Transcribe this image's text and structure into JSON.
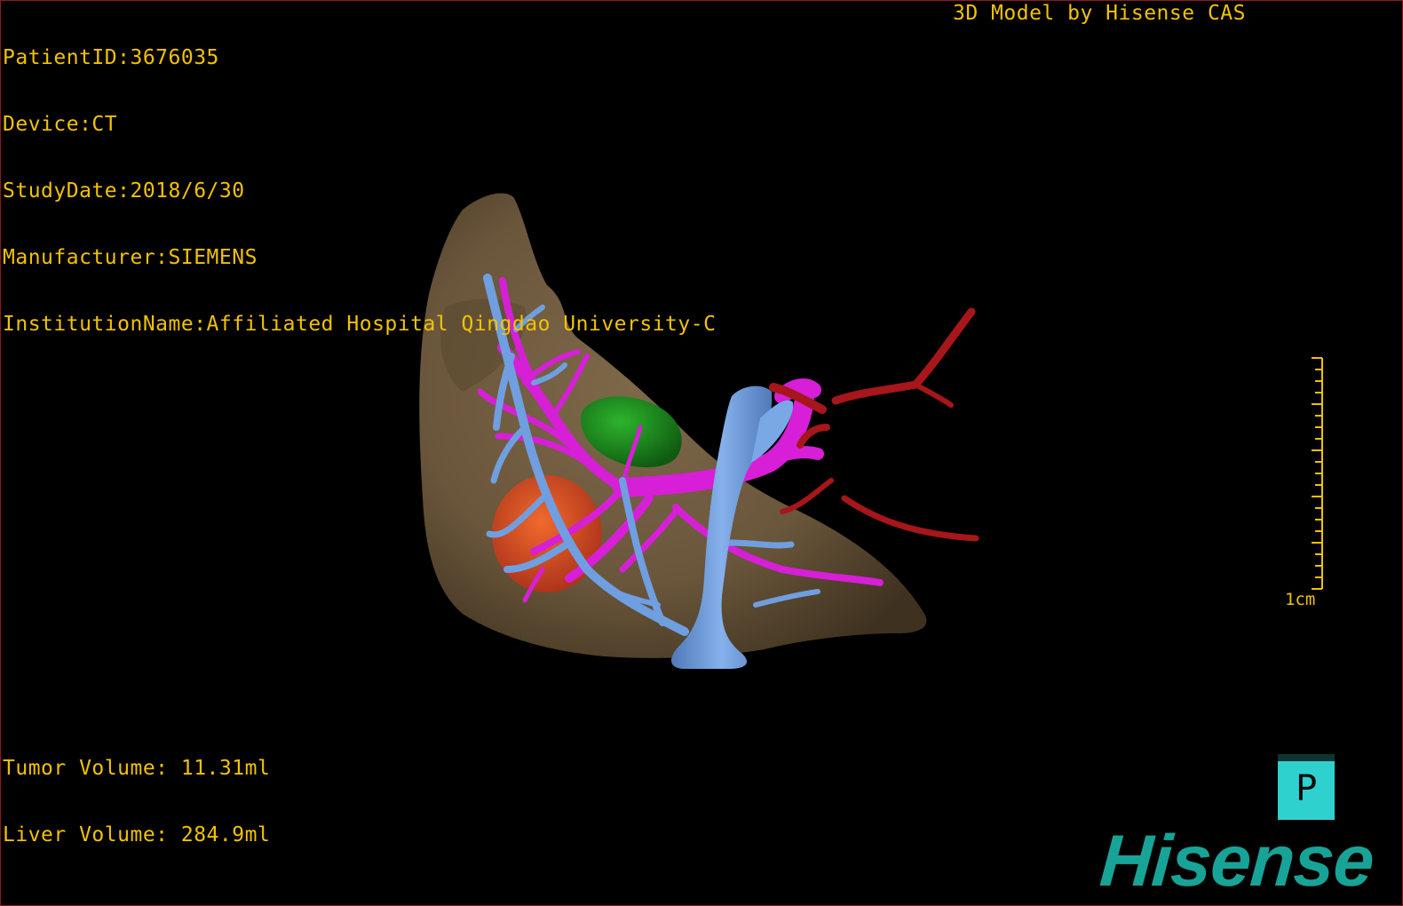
{
  "patient_info": {
    "patient_id": "PatientID:3676035",
    "device": "Device:CT",
    "study_date": "StudyDate:2018/6/30",
    "manufacturer": "Manufacturer:SIEMENS",
    "institution": "InstitutionName:Affiliated Hospital Qingdao University-C"
  },
  "credit": "3D Model by Hisense CAS",
  "volumes": {
    "tumor": "Tumor Volume: 11.31ml",
    "liver": "Liver Volume: 284.9ml"
  },
  "scale_bar": {
    "label": "1cm"
  },
  "orientation_cube": {
    "label": "P"
  },
  "brand": "Hisense",
  "colors": {
    "hud_text": "#f2c200",
    "liver": "#6e5a3e",
    "hepatic_vein": "#6f9fe0",
    "portal_vein": "#d61fd6",
    "artery": "#a6161a",
    "tumor_green": "#1f8f1f",
    "tumor_orange": "#e0501e",
    "orientation_box": "#2fd1cf",
    "brand": "#18a397"
  }
}
